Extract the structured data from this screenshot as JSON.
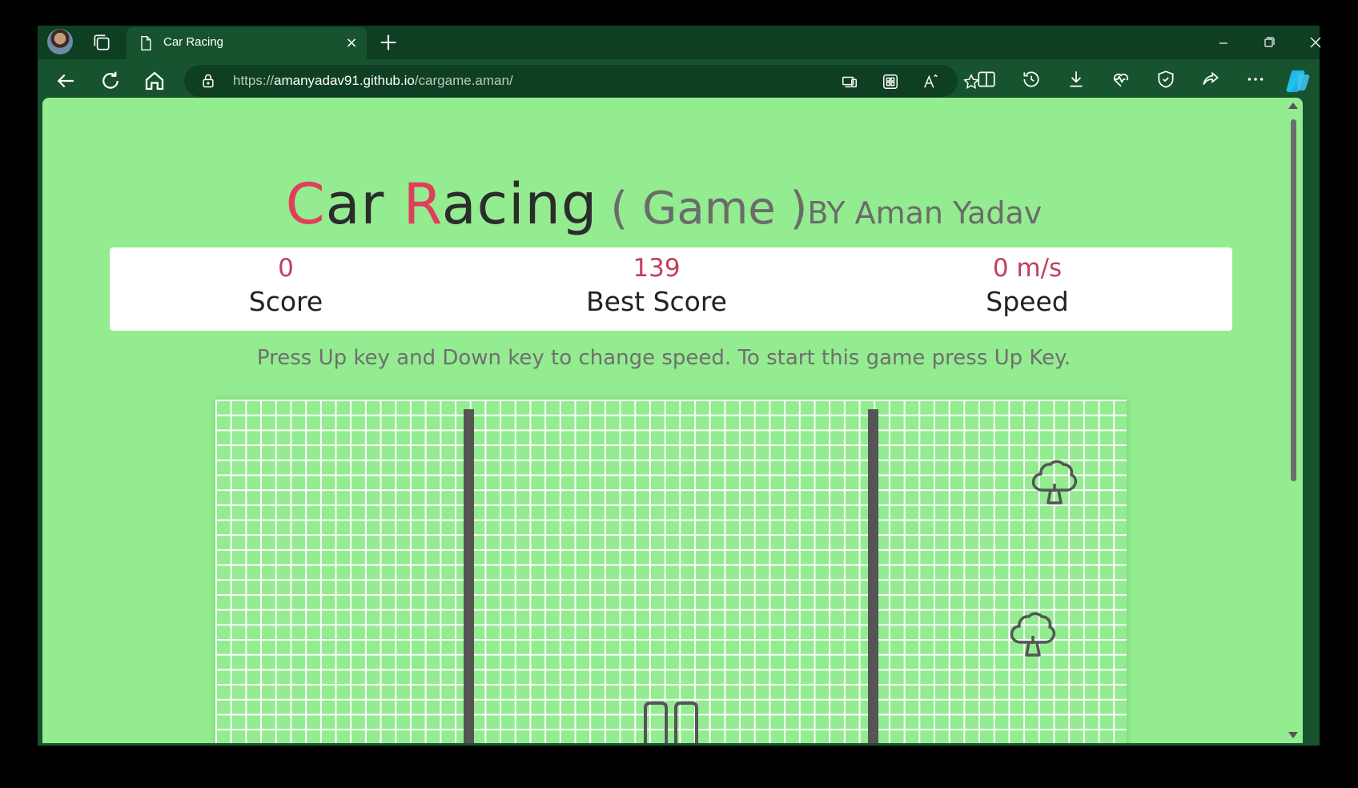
{
  "browser": {
    "tab_title": "Car Racing",
    "tab_close": "×",
    "url_prefix": "https://",
    "url_host": "amanyadav91.github.io",
    "url_path": "/cargame.aman/"
  },
  "icons": [
    "avatar",
    "workspaces-icon",
    "page-icon",
    "close-icon",
    "new-tab-icon",
    "minimize-icon",
    "restore-icon",
    "close-window-icon",
    "back-icon",
    "refresh-icon",
    "home-icon",
    "lock-icon",
    "devices-icon",
    "apps-icon",
    "read-aloud-icon",
    "favorite-icon",
    "split-screen-icon",
    "history-icon",
    "download-icon",
    "performance-icon",
    "browser-essentials-icon",
    "share-icon",
    "more-icon",
    "copilot-icon",
    "tree-icon",
    "car-icon"
  ],
  "page": {
    "title_c": "C",
    "title_ar": "ar ",
    "title_r": "R",
    "title_acing": "acing",
    "title_game": "( Game )",
    "title_by": "BY Aman Yadav",
    "score_value": "0",
    "score_label": "Score",
    "best_value": "139",
    "best_label": "Best Score",
    "speed_value": "0 m/s",
    "speed_label": "Speed",
    "instructions": "Press Up key and Down key to change speed. To start this game press Up Key."
  },
  "colors": {
    "page_bg": "#93ec8f",
    "accent_red": "#e13e5b",
    "stat_value": "#c1405e",
    "browser_frame": "#17532f"
  }
}
